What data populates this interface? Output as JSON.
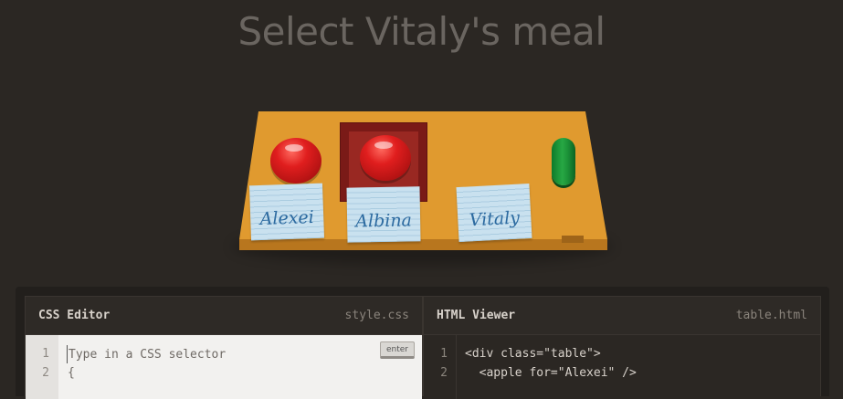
{
  "page": {
    "title": "Select Vitaly's meal"
  },
  "table_scene": {
    "notes": [
      {
        "name": "Alexei"
      },
      {
        "name": "Albina"
      },
      {
        "name": "Vitaly"
      }
    ],
    "items": [
      "apple-icon",
      "plate-icon",
      "apple-icon",
      "pickle-icon"
    ]
  },
  "css_editor": {
    "title": "CSS Editor",
    "filename": "style.css",
    "placeholder": "Type in a CSS selector",
    "enter_label": "enter",
    "line_numbers": [
      "1",
      "2"
    ],
    "line2": "{"
  },
  "html_viewer": {
    "title": "HTML Viewer",
    "filename": "table.html",
    "line_numbers": [
      "1",
      "2"
    ],
    "lines": [
      "<div class=\"table\">",
      "  <apple for=\"Alexei\" />"
    ]
  },
  "colors": {
    "background": "#2b2723",
    "table": "#e09a2f",
    "apple": "#e01e1e",
    "pickle": "#27a844",
    "note": "#c9e1ef"
  }
}
